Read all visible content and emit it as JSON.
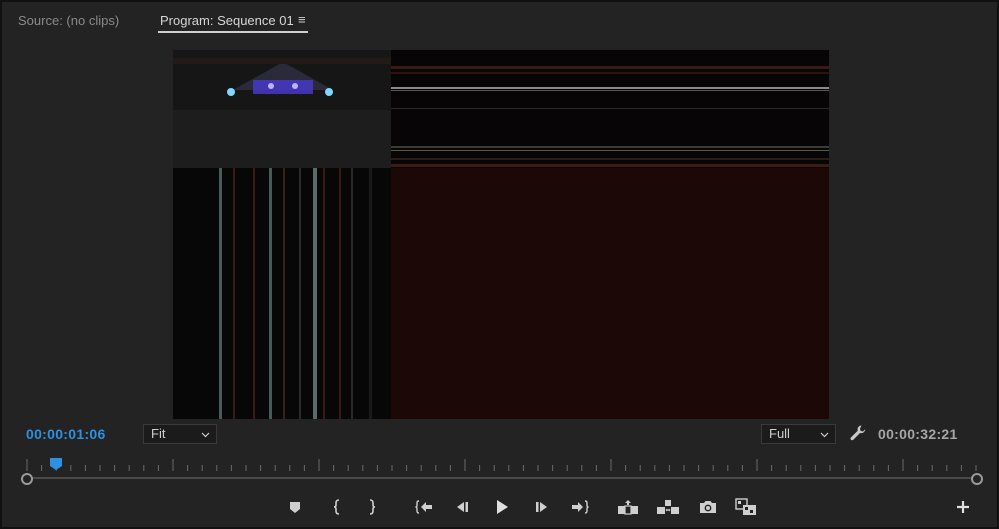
{
  "tabs": {
    "source": "Source: (no clips)",
    "program": "Program: Sequence 01",
    "menu_icon": "≡"
  },
  "timecode": {
    "current": "00:00:01:06",
    "duration": "00:00:32:21"
  },
  "zoom_dropdown": {
    "selected": "Fit"
  },
  "resolution_dropdown": {
    "selected": "Full"
  },
  "playhead_position_fraction": 0.039,
  "colors": {
    "accent": "#2f8fe0",
    "panel_bg": "#232323",
    "text": "#a6a6a6"
  },
  "transport_buttons": [
    {
      "name": "add-marker-button",
      "icon": "marker-icon"
    },
    {
      "name": "mark-in-button",
      "icon": "mark-in-icon"
    },
    {
      "name": "mark-out-button",
      "icon": "mark-out-icon"
    },
    {
      "name": "go-to-in-button",
      "icon": "go-to-in-icon"
    },
    {
      "name": "step-back-button",
      "icon": "step-back-icon"
    },
    {
      "name": "play-button",
      "icon": "play-icon"
    },
    {
      "name": "step-forward-button",
      "icon": "step-forward-icon"
    },
    {
      "name": "go-to-out-button",
      "icon": "go-to-out-icon"
    },
    {
      "name": "lift-button",
      "icon": "lift-icon"
    },
    {
      "name": "extract-button",
      "icon": "extract-icon"
    },
    {
      "name": "export-frame-button",
      "icon": "camera-icon"
    },
    {
      "name": "comparison-view-button",
      "icon": "comparison-icon"
    },
    {
      "name": "button-editor-button",
      "icon": "plus-icon"
    }
  ]
}
